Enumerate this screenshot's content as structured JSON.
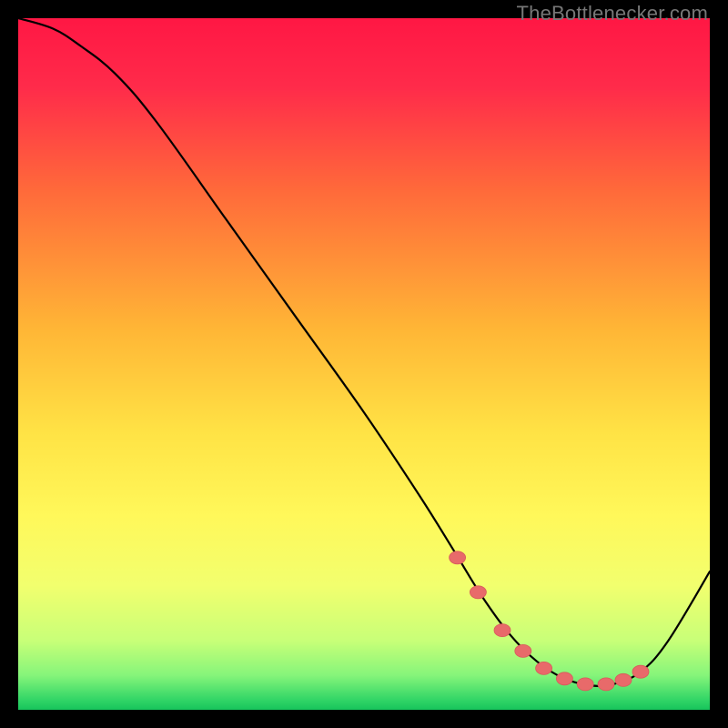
{
  "watermark": "TheBottlenecker.com",
  "colors": {
    "frame": "#000000",
    "curve": "#000000",
    "marker_fill": "#e86a6a",
    "marker_stroke": "#d85a5a",
    "gradient_stops": [
      {
        "offset": 0.0,
        "color": "#ff1744"
      },
      {
        "offset": 0.1,
        "color": "#ff2b4a"
      },
      {
        "offset": 0.25,
        "color": "#ff6a3a"
      },
      {
        "offset": 0.45,
        "color": "#ffb636"
      },
      {
        "offset": 0.6,
        "color": "#ffe345"
      },
      {
        "offset": 0.72,
        "color": "#fff85a"
      },
      {
        "offset": 0.82,
        "color": "#f2ff6e"
      },
      {
        "offset": 0.9,
        "color": "#c8ff78"
      },
      {
        "offset": 0.95,
        "color": "#86f57a"
      },
      {
        "offset": 0.985,
        "color": "#33d667"
      },
      {
        "offset": 1.0,
        "color": "#17c45c"
      }
    ]
  },
  "chart_data": {
    "type": "line",
    "title": "",
    "xlabel": "",
    "ylabel": "",
    "xlim": [
      0,
      100
    ],
    "ylim": [
      0,
      100
    ],
    "note": "Axes and ticks are not displayed; values estimated from curve shape relative to plot box.",
    "series": [
      {
        "name": "bottleneck-curve",
        "x": [
          0,
          5,
          9,
          14,
          20,
          30,
          40,
          50,
          58,
          63,
          67,
          71,
          75,
          79,
          83,
          86,
          90,
          94,
          100
        ],
        "y": [
          100,
          98.5,
          96,
          92,
          85,
          71,
          57,
          43,
          31,
          23,
          16.5,
          11,
          7,
          4.5,
          3.5,
          3.7,
          5.5,
          10,
          20
        ]
      }
    ],
    "markers": {
      "name": "highlighted-points",
      "x": [
        63.5,
        66.5,
        70,
        73,
        76,
        79,
        82,
        85,
        87.5,
        90
      ],
      "y": [
        22,
        17,
        11.5,
        8.5,
        6,
        4.5,
        3.7,
        3.7,
        4.3,
        5.5
      ]
    }
  }
}
